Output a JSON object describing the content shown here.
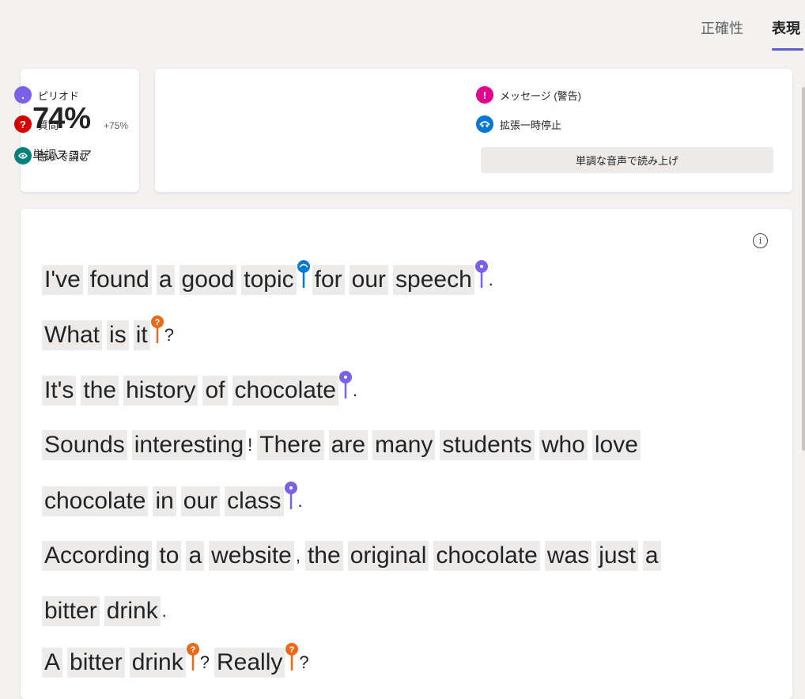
{
  "tabs": {
    "accuracy": "正確性",
    "expression": "表現"
  },
  "score": {
    "value": "74%",
    "delta": "+75%",
    "label": "単調スコア"
  },
  "legend": {
    "period": {
      "icon": ".",
      "label": "ピリオド",
      "color": "#7b61e8"
    },
    "question": {
      "icon": "?",
      "label": "質問",
      "color": "#d50000"
    },
    "rushed": {
      "icon": "fast-reading-icon",
      "label": "急いで読む",
      "color": "#00827a"
    },
    "message": {
      "icon": "!",
      "label": "メッセージ (警告)",
      "color": "#e3008c"
    },
    "pause": {
      "icon": "pause-icon",
      "label": "拡張一時停止",
      "color": "#0078d4"
    },
    "mono_button": "単調な音声で読み上げ"
  },
  "info_icon": "i",
  "text": {
    "l1": {
      "w1": "I've",
      "w2": "found",
      "w3": "a",
      "w4": "good",
      "w5": "topic",
      "w6": "for",
      "w7": "our",
      "w8": "speech",
      "p1": "."
    },
    "l2": {
      "w1": "What",
      "w2": "is",
      "w3": "it",
      "p1": "?"
    },
    "l3": {
      "w1": "It's",
      "w2": "the",
      "w3": "history",
      "w4": "of",
      "w5": "chocolate",
      "p1": "."
    },
    "l4": {
      "w1": "Sounds",
      "w2": "interesting",
      "p1": "!",
      "w3": "There",
      "w4": "are",
      "w5": "many",
      "w6": "students",
      "w7": "who",
      "w8": "love"
    },
    "l5": {
      "w1": "chocolate",
      "w2": "in",
      "w3": "our",
      "w4": "class",
      "p1": "."
    },
    "l6": {
      "w1": "According",
      "w2": "to",
      "w3": "a",
      "w4": "website",
      "p1": ",",
      "w5": "the",
      "w6": "original",
      "w7": "chocolate",
      "w8": "was",
      "w9": "just",
      "w10": "a"
    },
    "l7": {
      "w1": "bitter",
      "w2": "drink",
      "p1": "."
    },
    "l8": {
      "w1": "A",
      "w2": "bitter",
      "w3": "drink",
      "p1": "?",
      "w4": "Really",
      "p2": "?"
    }
  }
}
